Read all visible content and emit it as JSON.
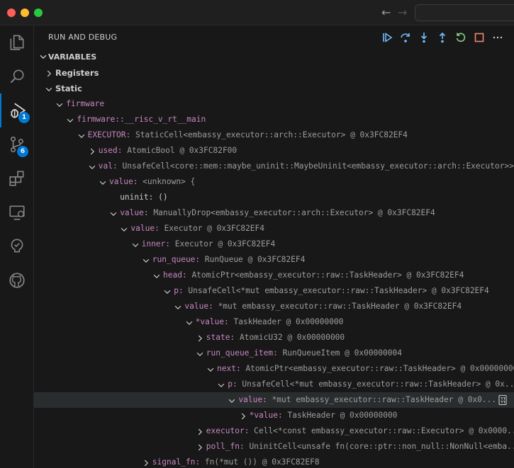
{
  "window": {
    "back_label": "←",
    "forward_label": "→"
  },
  "activity_bar": {
    "run_debug_badge": "1",
    "source_control_badge": "6"
  },
  "run_debug": {
    "header_title": "RUN AND DEBUG",
    "variables_title": "VARIABLES"
  },
  "tree": [
    {
      "depth": 0,
      "twist": "closed",
      "scope": true,
      "name": "Registers",
      "value": ""
    },
    {
      "depth": 0,
      "twist": "open",
      "scope": true,
      "name": "Static",
      "value": ""
    },
    {
      "depth": 1,
      "twist": "open",
      "name": "firmware",
      "value": ""
    },
    {
      "depth": 2,
      "twist": "open",
      "name": "firmware::__risc_v_rt__main",
      "value": ""
    },
    {
      "depth": 3,
      "twist": "open",
      "name": "EXECUTOR",
      "value": "StaticCell<embassy_executor::arch::Executor> @ 0x3FC82EF4"
    },
    {
      "depth": 4,
      "twist": "closed",
      "name": "used",
      "value": "AtomicBool @ 0x3FC82F00"
    },
    {
      "depth": 4,
      "twist": "open",
      "name": "val",
      "value": "UnsafeCell<core::mem::maybe_uninit::MaybeUninit<embassy_executor::arch::Executor>>..."
    },
    {
      "depth": 5,
      "twist": "open",
      "name": "value",
      "value": "<unknown> {"
    },
    {
      "depth": 6,
      "twist": "none",
      "name": "uninit",
      "value": "()",
      "plain": true
    },
    {
      "depth": 6,
      "twist": "open",
      "name": "value",
      "value": "ManuallyDrop<embassy_executor::arch::Executor> @ 0x3FC82EF4"
    },
    {
      "depth": 7,
      "twist": "open",
      "name": "value",
      "value": "Executor @ 0x3FC82EF4"
    },
    {
      "depth": 8,
      "twist": "open",
      "name": "inner",
      "value": "Executor @ 0x3FC82EF4"
    },
    {
      "depth": 9,
      "twist": "open",
      "name": "run_queue",
      "value": "RunQueue @ 0x3FC82EF4"
    },
    {
      "depth": 10,
      "twist": "open",
      "name": "head",
      "value": "AtomicPtr<embassy_executor::raw::TaskHeader> @ 0x3FC82EF4"
    },
    {
      "depth": 11,
      "twist": "open",
      "name": "p",
      "value": "UnsafeCell<*mut embassy_executor::raw::TaskHeader> @ 0x3FC82EF4"
    },
    {
      "depth": 12,
      "twist": "open",
      "name": "value",
      "value": "*mut embassy_executor::raw::TaskHeader @ 0x3FC82EF4"
    },
    {
      "depth": 13,
      "twist": "open",
      "name": "*value",
      "value": "TaskHeader @ 0x00000000"
    },
    {
      "depth": 14,
      "twist": "closed",
      "name": "state",
      "value": "AtomicU32 @ 0x00000000"
    },
    {
      "depth": 14,
      "twist": "open",
      "name": "run_queue_item",
      "value": "RunQueueItem @ 0x00000004"
    },
    {
      "depth": 15,
      "twist": "open",
      "name": "next",
      "value": "AtomicPtr<embassy_executor::raw::TaskHeader> @ 0x00000000..."
    },
    {
      "depth": 16,
      "twist": "open",
      "name": "p",
      "value": "UnsafeCell<*mut embassy_executor::raw::TaskHeader> @ 0x..."
    },
    {
      "depth": 17,
      "twist": "open",
      "name": "value",
      "value": "*mut embassy_executor::raw::TaskHeader @ 0x0...",
      "selected": true
    },
    {
      "depth": 18,
      "twist": "closed",
      "name": "*value",
      "value": "TaskHeader @ 0x00000000"
    },
    {
      "depth": 14,
      "twist": "closed",
      "name": "executor",
      "value": "Cell<*const embassy_executor::raw::Executor> @ 0x0000..."
    },
    {
      "depth": 14,
      "twist": "closed",
      "name": "poll_fn",
      "value": "UninitCell<unsafe fn(core::ptr::non_null::NonNull<emba..."
    },
    {
      "depth": 9,
      "twist": "closed",
      "name": "signal_fn",
      "value": "fn(*mut ()) @ 0x3FC82EF8"
    }
  ],
  "colors": {
    "accent": "#0078d4",
    "continue": "#75beff",
    "restart": "#89d185",
    "stop": "#f48771",
    "var_name": "#c586c0",
    "var_value": "#9d9d9d"
  }
}
